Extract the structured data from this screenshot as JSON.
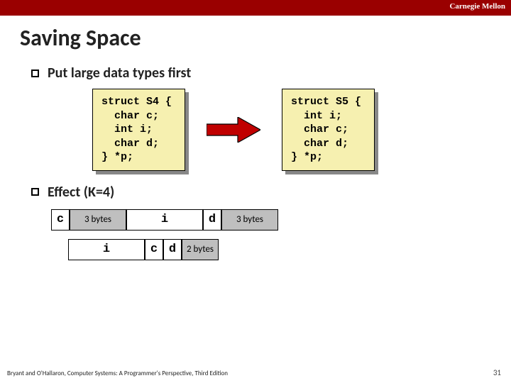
{
  "header": {
    "university": "Carnegie Mellon"
  },
  "title": "Saving Space",
  "bullets": {
    "b1": "Put large data types first",
    "b2": "Effect (K=4)"
  },
  "code": {
    "left": "struct S4 {\n  char c;\n  int i;\n  char d;\n} *p;",
    "right": "struct S5 {\n  int i;\n  char c;\n  char d;\n} *p;"
  },
  "layout_s4": {
    "c": "c",
    "pad3a": "3 bytes",
    "i": "i",
    "d": "d",
    "pad3b": "3 bytes"
  },
  "layout_s5": {
    "i": "i",
    "c": "c",
    "d": "d",
    "pad2": "2 bytes"
  },
  "footer": "Bryant and O'Hallaron, Computer Systems: A Programmer's Perspective, Third Edition",
  "page": "31"
}
